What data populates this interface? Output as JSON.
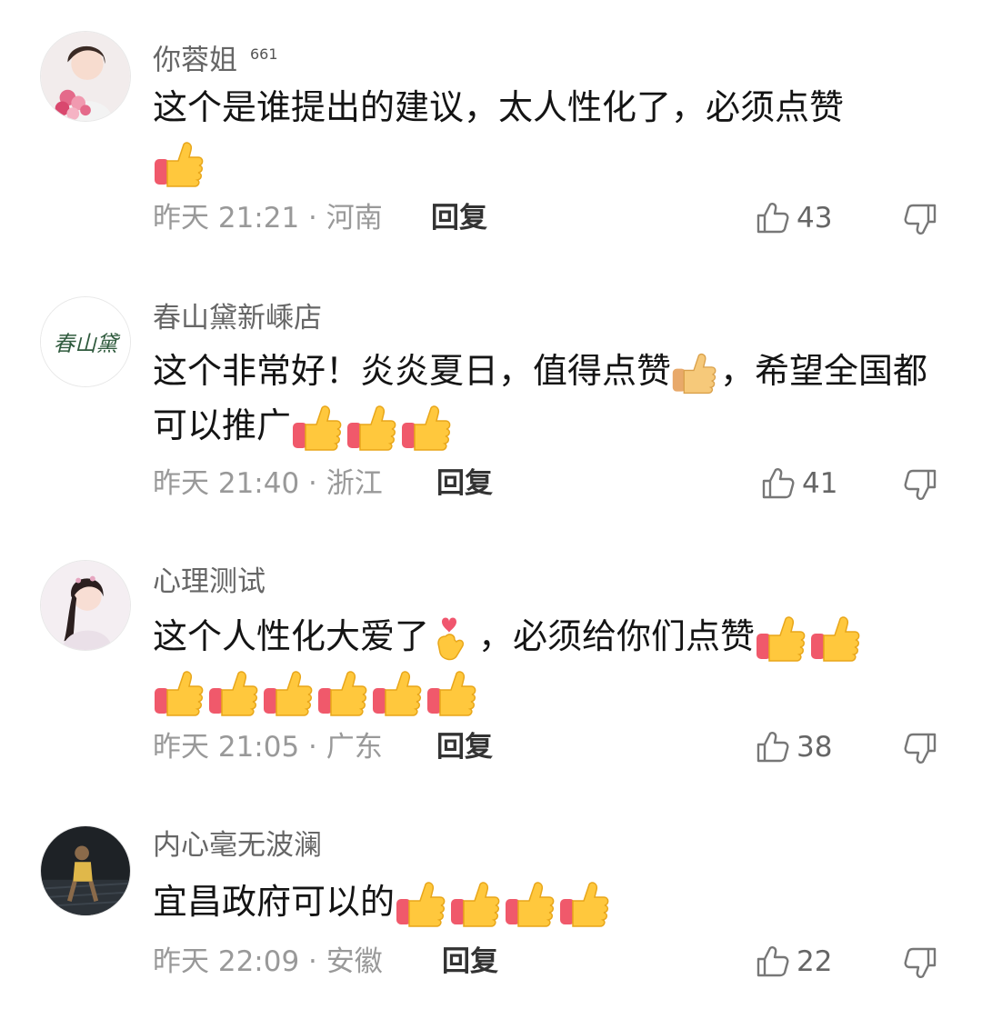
{
  "comments": [
    {
      "username": "你蓉姐",
      "badge": "661",
      "text_parts": [
        "这个是谁提出的建议，太人性化了，必须点赞"
      ],
      "time_loc": "昨天 21:21 · 河南",
      "reply_label": "回复",
      "likes": "43"
    },
    {
      "username": "春山黛新嵊店",
      "avatar_text": "春山黛",
      "text_parts": [
        "这个非常好！炎炎夏日，值得点赞",
        "，希望全国都可以推广"
      ],
      "time_loc": "昨天 21:40 · 浙江",
      "reply_label": "回复",
      "likes": "41"
    },
    {
      "username": "心理测试",
      "text_parts": [
        "这个人性化大爱了",
        "，必须给你们点赞"
      ],
      "time_loc": "昨天 21:05 · 广东",
      "reply_label": "回复",
      "likes": "38"
    },
    {
      "username": "内心毫无波澜",
      "text_parts": [
        "宜昌政府可以的"
      ],
      "time_loc": "昨天 22:09 · 安徽",
      "reply_label": "回复",
      "likes": "22"
    }
  ],
  "icons": {
    "like": "thumbs-up-outline-icon",
    "dislike": "thumbs-down-outline-icon",
    "emoji_thumb": "thumbs-up-emoji-icon",
    "emoji_heart": "finger-heart-emoji-icon"
  },
  "colors": {
    "thumb_yellow": "#FFC83D",
    "cuff_red": "#F0596B",
    "meta_gray": "#999999"
  }
}
